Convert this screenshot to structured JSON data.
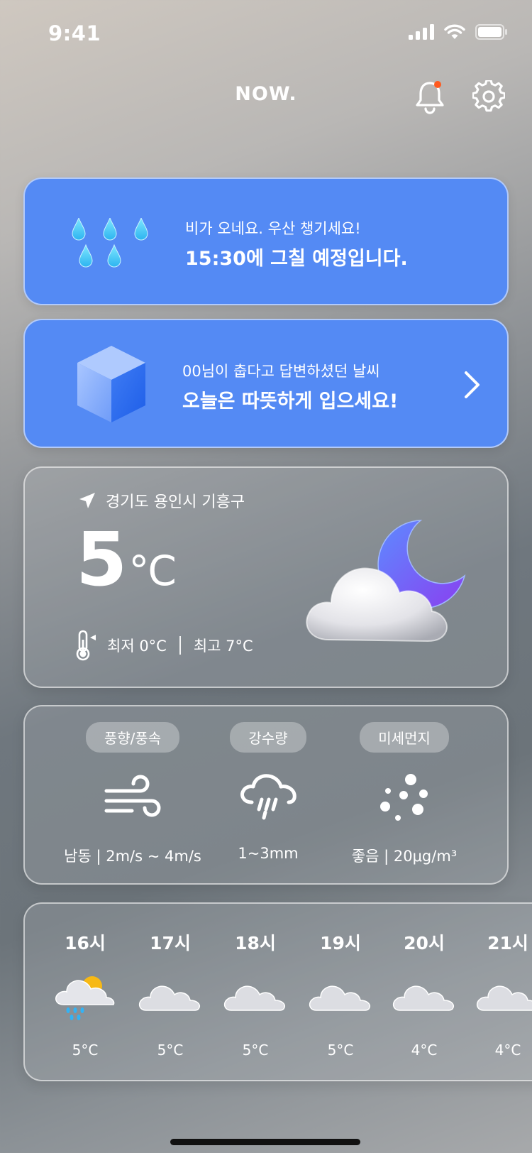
{
  "status": {
    "time": "9:41"
  },
  "header": {
    "logo": "NOW."
  },
  "rain_alert": {
    "subtitle": "비가 오네요. 우산 챙기세요!",
    "title": "15:30에 그칠 예정입니다."
  },
  "outfit": {
    "subtitle": "00님이 춥다고 답변하셨던 날씨",
    "title": "오늘은 따뜻하게 입으세요!"
  },
  "current": {
    "location": "경기도 용인시 기흥구",
    "temp": "5",
    "unit": "°C",
    "min": "최저 0°C",
    "max": "최고 7°C"
  },
  "metrics": [
    {
      "label": "풍향/풍속",
      "value": "남동 | 2m/s ~ 4m/s",
      "icon": "wind-icon"
    },
    {
      "label": "강수량",
      "value": "1~3mm",
      "icon": "rain-cloud-icon"
    },
    {
      "label": "미세먼지",
      "value": "좋음 | 20μg/m³",
      "icon": "dust-icon"
    }
  ],
  "hourly": [
    {
      "hour": "16시",
      "temp": "5°C",
      "icon": "sun-rain-icon"
    },
    {
      "hour": "17시",
      "temp": "5°C",
      "icon": "cloud-icon"
    },
    {
      "hour": "18시",
      "temp": "5°C",
      "icon": "cloud-icon"
    },
    {
      "hour": "19시",
      "temp": "5°C",
      "icon": "cloud-icon"
    },
    {
      "hour": "20시",
      "temp": "4°C",
      "icon": "cloud-icon"
    },
    {
      "hour": "21시",
      "temp": "4°C",
      "icon": "cloud-icon"
    }
  ],
  "colors": {
    "accent_blue": "#548af4",
    "notification_dot": "#ff5a1f",
    "moon": "#7a5cf0"
  }
}
